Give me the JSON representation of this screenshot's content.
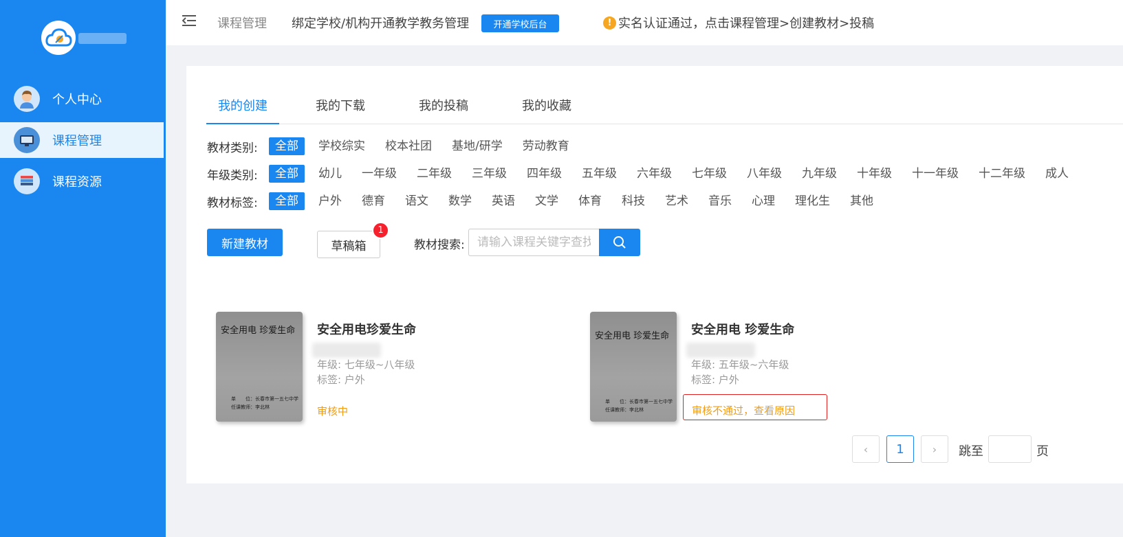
{
  "colors": {
    "primary": "#1a86f0",
    "warning": "#f39c12",
    "danger": "#e02020",
    "badge": "#f5222d"
  },
  "sidebar": {
    "items": [
      {
        "label": "个人中心",
        "icon": "user-avatar-icon"
      },
      {
        "label": "课程管理",
        "icon": "monitor-icon",
        "active": true
      },
      {
        "label": "课程资源",
        "icon": "books-icon"
      }
    ]
  },
  "header": {
    "breadcrumb": "课程管理",
    "bind_text": "绑定学校/机构开通教学教务管理",
    "open_button": "开通学校后台",
    "notice_icon": "!",
    "notice": "实名认证通过，点击课程管理>创建教材>投稿"
  },
  "tabs": [
    "我的创建",
    "我的下载",
    "我的投稿",
    "我的收藏"
  ],
  "filters": {
    "category": {
      "label": "教材类别:",
      "options": [
        "全部",
        "学校综实",
        "校本社团",
        "基地/研学",
        "劳动教育"
      ]
    },
    "grade": {
      "label": "年级类别:",
      "options": [
        "全部",
        "幼儿",
        "一年级",
        "二年级",
        "三年级",
        "四年级",
        "五年级",
        "六年级",
        "七年级",
        "八年级",
        "九年级",
        "十年级",
        "十一年级",
        "十二年级",
        "成人"
      ]
    },
    "tag": {
      "label": "教材标签:",
      "options": [
        "全部",
        "户外",
        "德育",
        "语文",
        "数学",
        "英语",
        "文学",
        "体育",
        "科技",
        "艺术",
        "音乐",
        "心理",
        "理化生",
        "其他"
      ]
    }
  },
  "actions": {
    "new_button": "新建教材",
    "draft_button": "草稿箱",
    "draft_count": "1",
    "search_label": "教材搜索:",
    "search_placeholder": "请输入课程关键字查找"
  },
  "cards": [
    {
      "cover_title": "安全用电  珍爱生命",
      "cover_unit": "单　　位：长春市第一五七中学",
      "cover_teacher": "任课教师：李北林",
      "title": "安全用电珍爱生命",
      "grade": "年级: 七年级~八年级",
      "tag": "标签: 户外",
      "status": "审核中"
    },
    {
      "cover_title": "安全用电  珍爱生命",
      "cover_unit": "单　　位：长春市第一五七中学",
      "cover_teacher": "任课教师：李北林",
      "title": "安全用电 珍爱生命",
      "grade": "年级: 五年级~六年级",
      "tag": "标签: 户外",
      "status": "审核不通过，查看原因"
    }
  ],
  "pagination": {
    "prev": "‹",
    "current": "1",
    "next": "›",
    "jump_label": "跳至",
    "page_unit": "页"
  }
}
